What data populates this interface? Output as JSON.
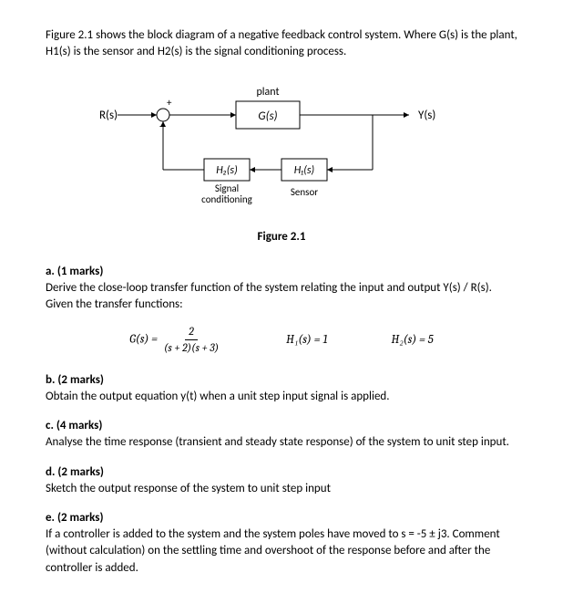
{
  "intro": "Figure 2.1 shows the block diagram of a negative feedback control system. Where G(s) is the plant, H1(s) is the sensor and H2(s) is the signal conditioning process.",
  "diagram": {
    "plant_label": "plant",
    "input": "R(s)",
    "plant_block": "G(s)",
    "output": "Y(s)",
    "h2_block": "H₂(s)",
    "h2_label_line1": "Signal",
    "h2_label_line2": "conditioning",
    "h1_block": "H₁(s)",
    "h1_label": "Sensor",
    "caption": "Figure 2.1"
  },
  "parts": {
    "a": {
      "head": "a. (1 marks)",
      "text": "Derive the close-loop transfer function of the system relating the input and output Y(s) / R(s). Given the transfer functions:",
      "g_lhs": "G(s) =",
      "g_num": "2",
      "g_den": "(s + 2)(s + 3)",
      "h1": "H₁(s) = 1",
      "h2": "H₂(s) = 5"
    },
    "b": {
      "head": "b. (2 marks)",
      "text": "Obtain the output equation y(t) when a unit step input signal is applied."
    },
    "c": {
      "head": "c. (4 marks)",
      "text": "Analyse the time response (transient and steady state response) of the system to unit step input."
    },
    "d": {
      "head": "d. (2 marks)",
      "text": "Sketch the output response of the system to unit step input"
    },
    "e": {
      "head": "e. (2 marks)",
      "text": "If a controller is added to the system and the system poles have moved to s = -5 ± j3. Comment (without calculation) on the settling time and overshoot of the response before and after the controller is added."
    }
  }
}
